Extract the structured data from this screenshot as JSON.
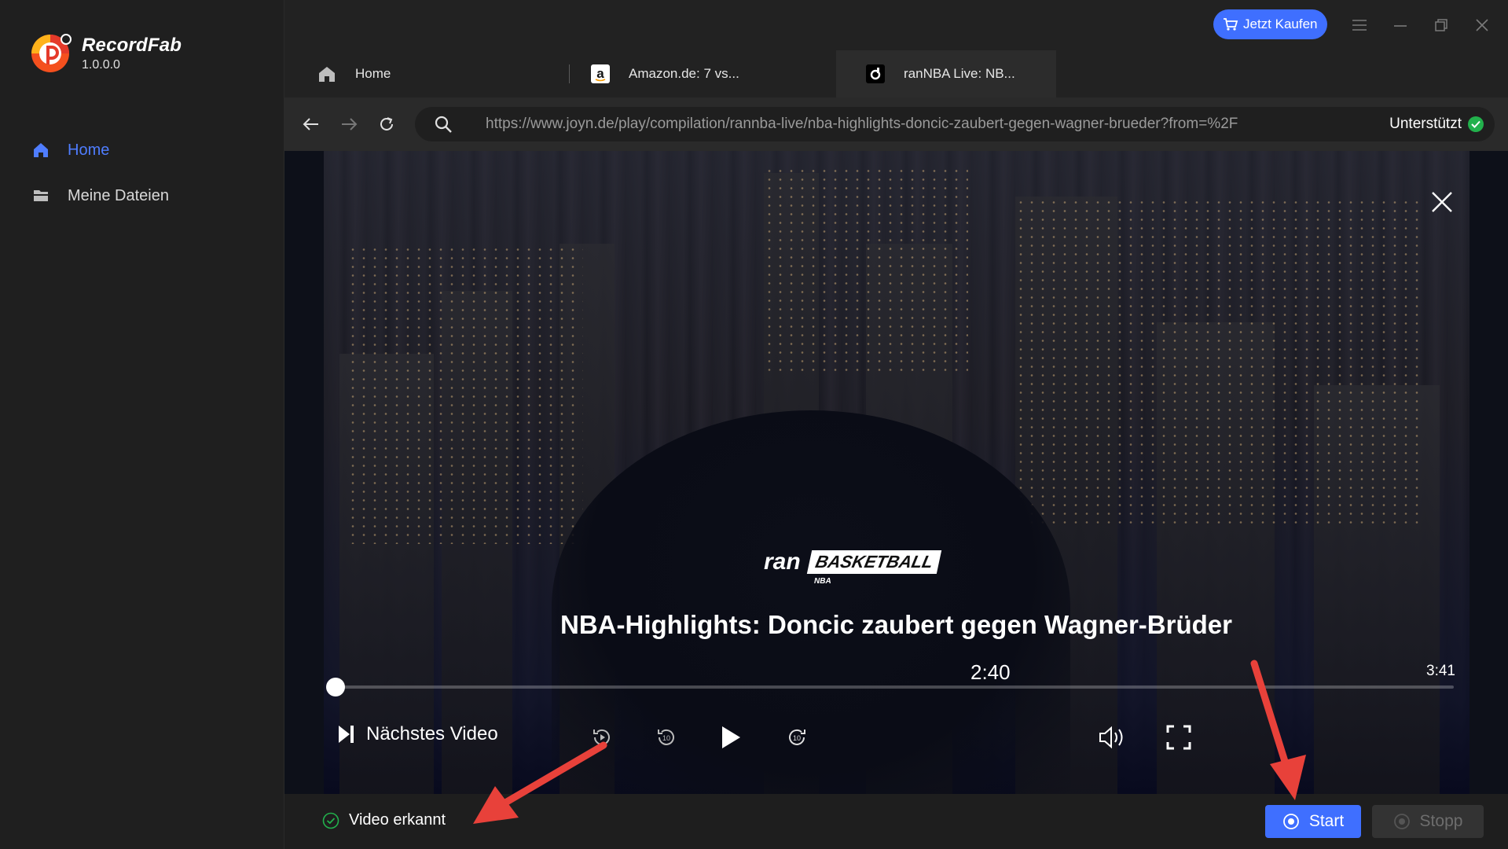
{
  "app": {
    "name": "RecordFab",
    "version": "1.0.0.0"
  },
  "sidebar": {
    "items": [
      {
        "label": "Home",
        "icon": "home-icon",
        "active": true
      },
      {
        "label": "Meine Dateien",
        "icon": "folder-icon",
        "active": false
      }
    ]
  },
  "titlebar": {
    "buy_label": "Jetzt Kaufen"
  },
  "tabs": [
    {
      "label": "Home",
      "icon": "home-icon"
    },
    {
      "label": "Amazon.de: 7 vs...",
      "icon": "amazon-icon"
    },
    {
      "label": "ranNBA Live: NB...",
      "icon": "joyn-icon",
      "active": true
    }
  ],
  "address": {
    "url": "https://www.joyn.de/play/compilation/rannba-live/nba-highlights-doncic-zaubert-gegen-wagner-brueder?from=%2F",
    "status": "Unterstützt"
  },
  "player": {
    "brand_ran": "ran",
    "brand_basketball": "BASKETBALL",
    "brand_nba": "NBA",
    "title": "NBA-Highlights: Doncic zaubert gegen Wagner-Brüder",
    "current_time": "2:40",
    "duration": "3:41",
    "progress_fraction": 0.005,
    "next_label": "Nächstes Video"
  },
  "bottom": {
    "detected_label": "Video erkannt",
    "start_label": "Start",
    "stop_label": "Stopp"
  },
  "colors": {
    "accent": "#3f6fff",
    "success": "#22b14c",
    "annotation": "#e8413a"
  }
}
